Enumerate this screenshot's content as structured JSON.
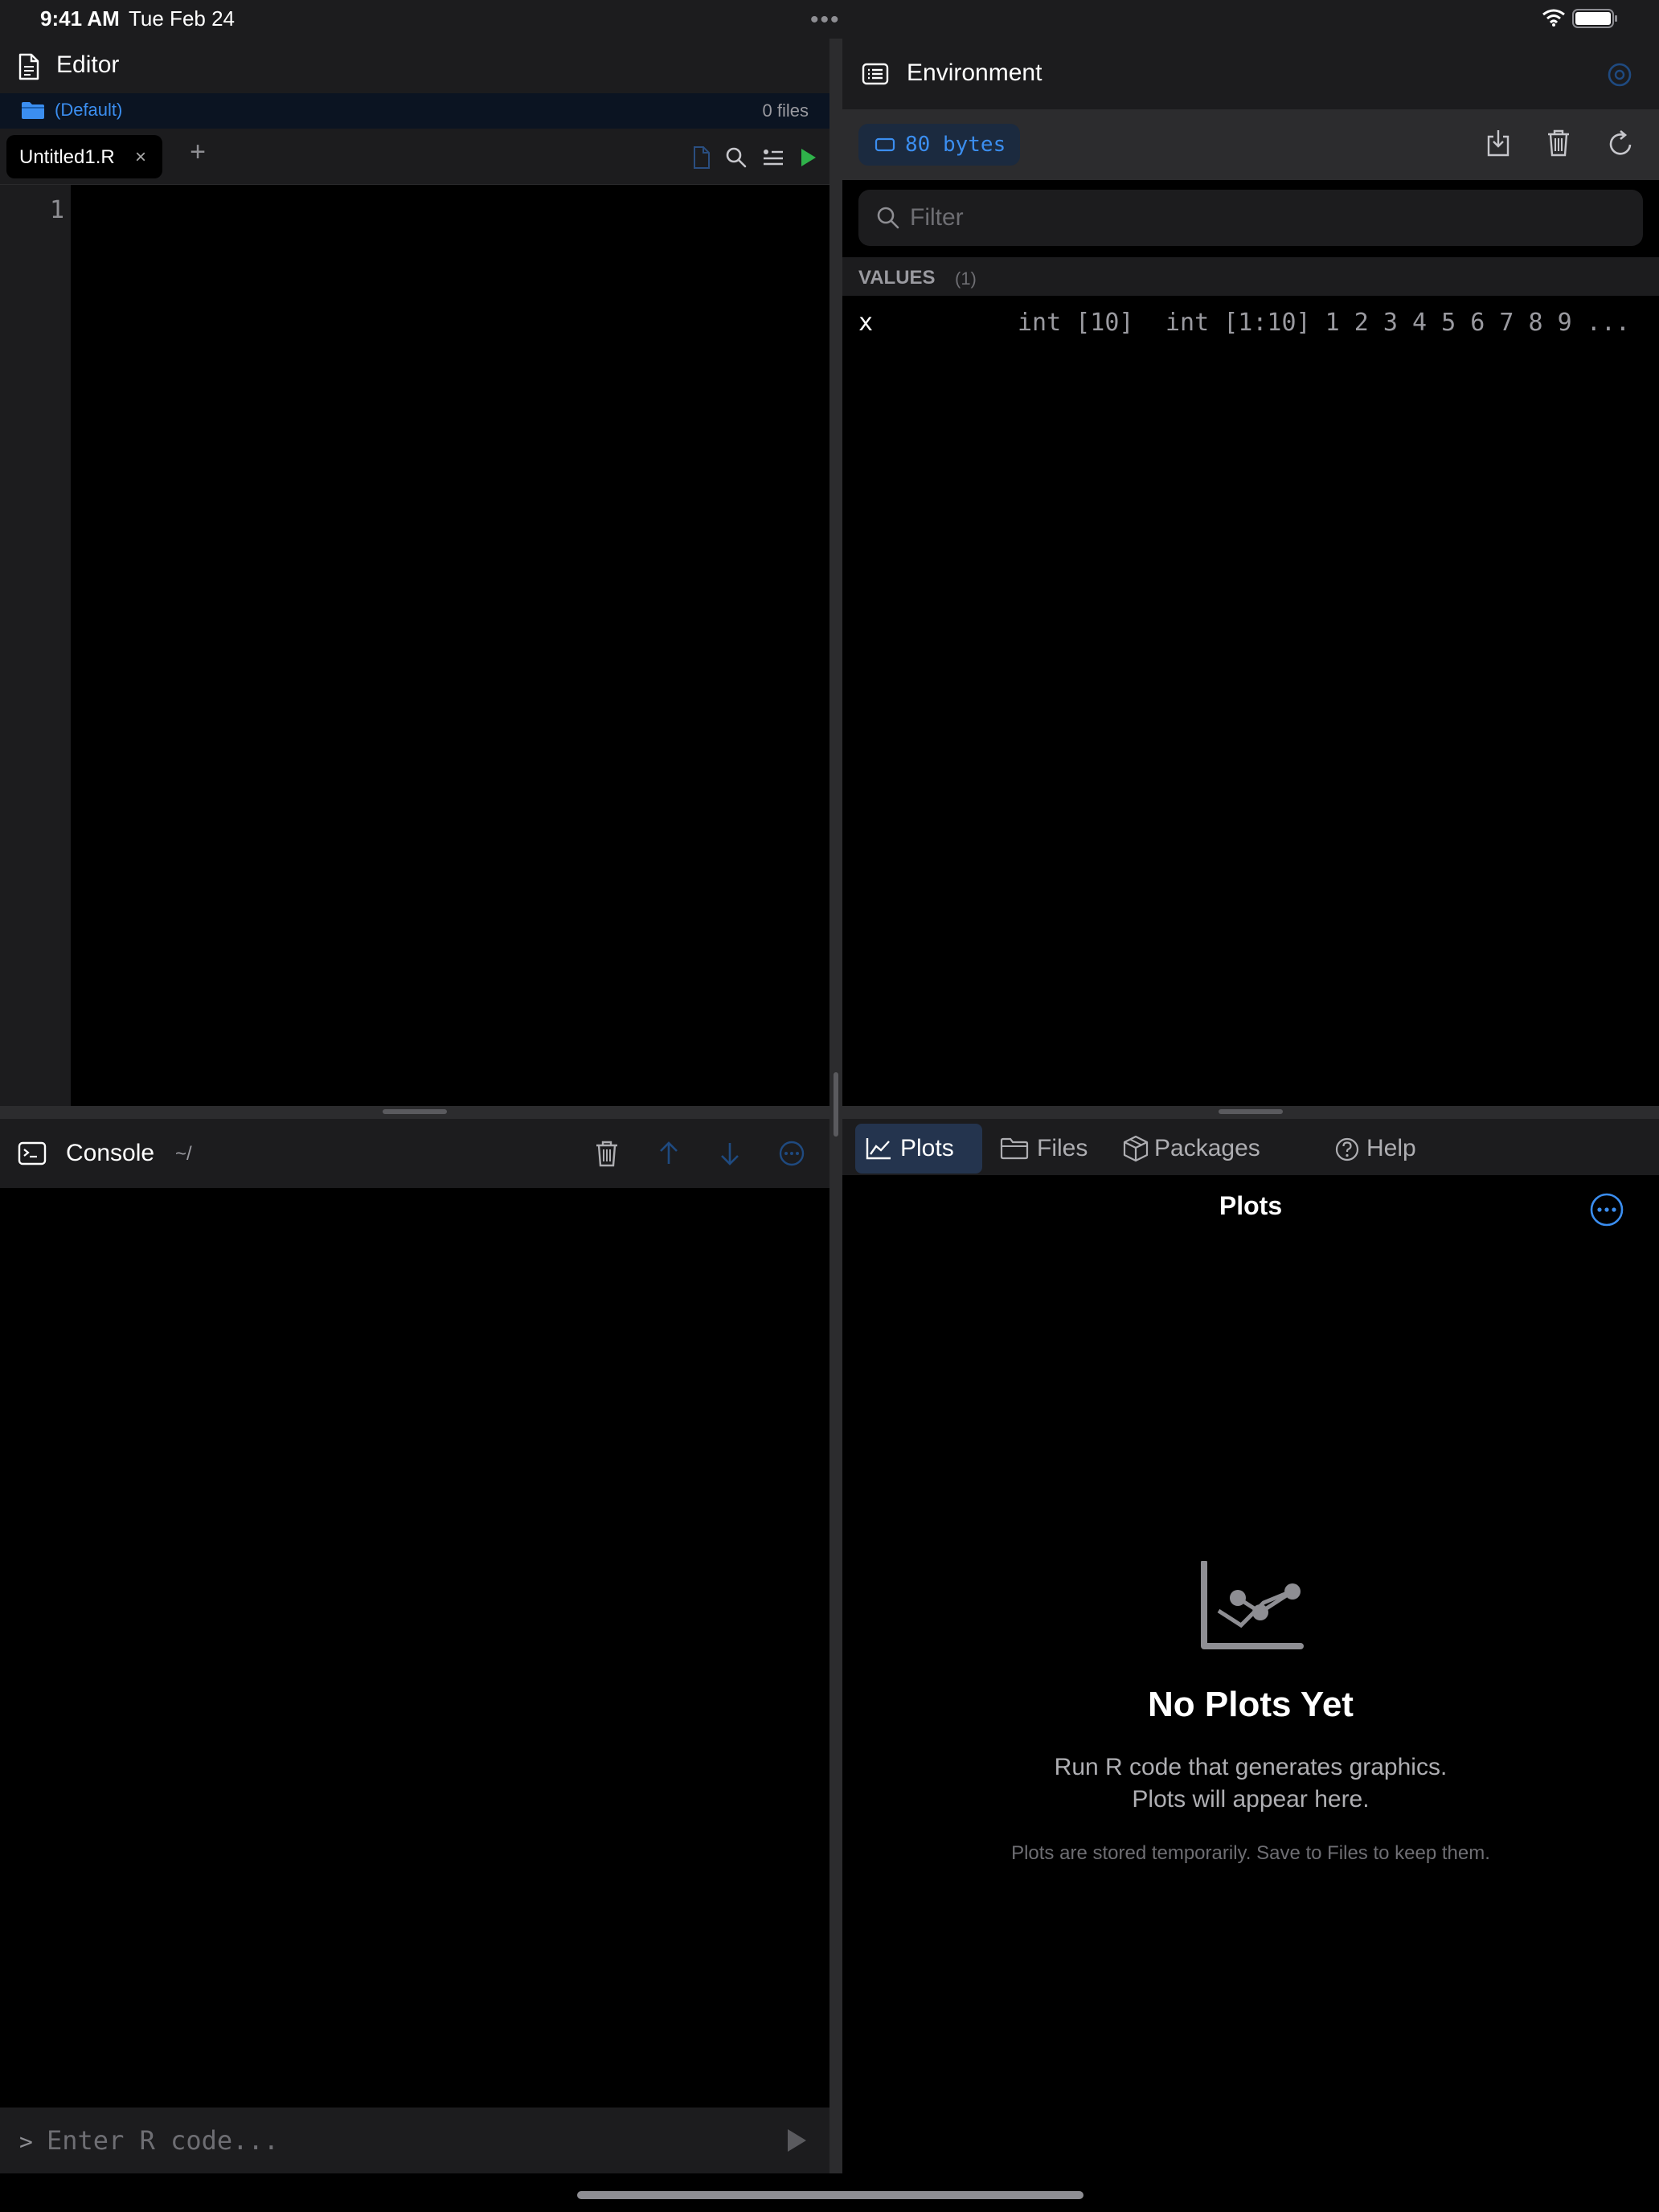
{
  "status_bar": {
    "time": "9:41 AM",
    "date": "Tue Feb 24"
  },
  "editor": {
    "title": "Editor",
    "project": {
      "name": "(Default)",
      "file_count": "0 files"
    },
    "tabs": [
      {
        "label": "Untitled1.R",
        "close": "×"
      }
    ],
    "add_tab": "+",
    "line_numbers": [
      "1"
    ]
  },
  "console": {
    "title": "Console",
    "path": "~/",
    "prompt": ">",
    "input_placeholder": "Enter R code..."
  },
  "environment": {
    "title": "Environment",
    "memory": "80 bytes",
    "filter_placeholder": "Filter",
    "section_label": "VALUES",
    "section_count": "(1)",
    "values": [
      {
        "name": "x",
        "type": "int [10]",
        "preview": "int [1:10] 1 2 3 4 5 6 7 8 9 ..."
      }
    ]
  },
  "bottom_tabs": [
    {
      "label": "Plots",
      "icon": "chart-line-icon",
      "active": true
    },
    {
      "label": "Files",
      "icon": "folder-icon",
      "active": false
    },
    {
      "label": "Packages",
      "icon": "package-icon",
      "active": false
    },
    {
      "label": "Help",
      "icon": "help-icon",
      "active": false
    }
  ],
  "plots": {
    "title": "Plots",
    "empty_title": "No Plots Yet",
    "empty_desc_1": "Run R code that generates graphics.",
    "empty_desc_2": "Plots will appear here.",
    "empty_note": "Plots are stored temporarily. Save to Files to keep them."
  },
  "colors": {
    "accent": "#3b8ef0",
    "run_green": "#2fb24a",
    "panel": "#1c1c1e",
    "background": "#000000",
    "active_tab": "#24344e"
  }
}
